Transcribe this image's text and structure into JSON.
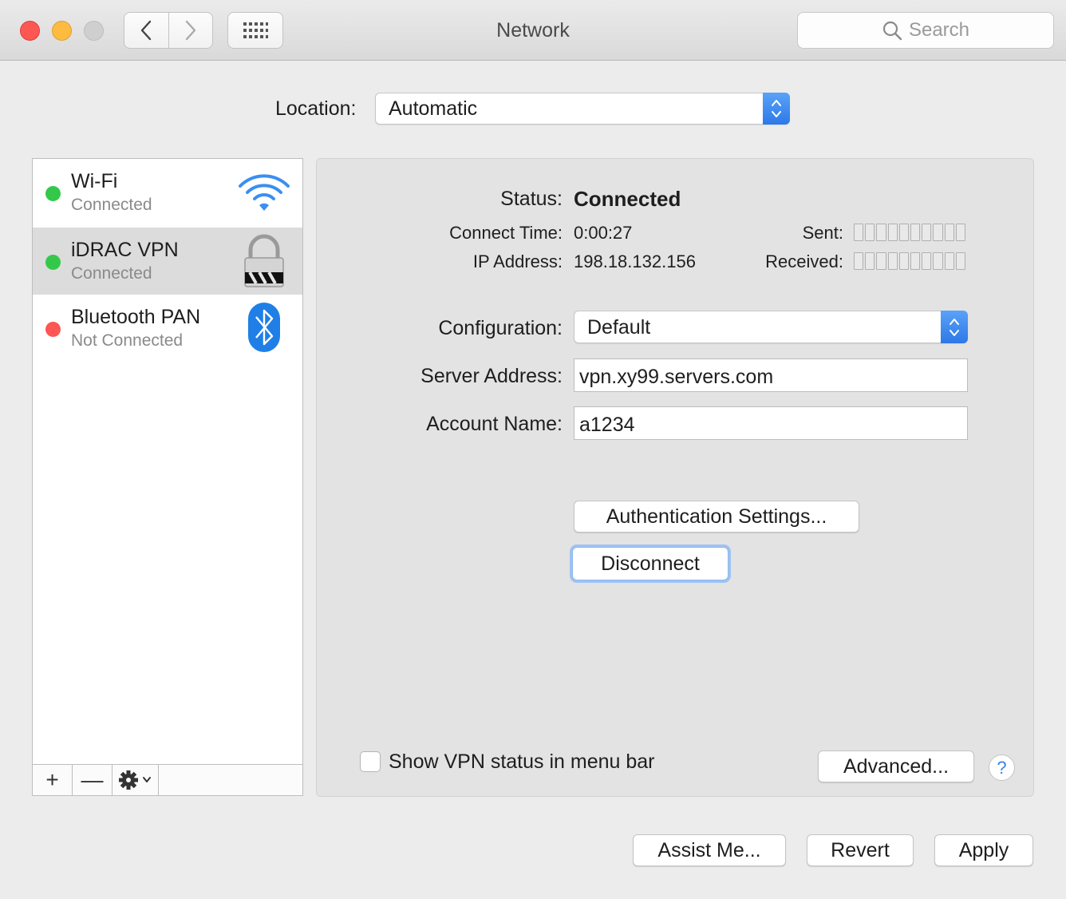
{
  "window": {
    "title": "Network",
    "search_placeholder": "Search"
  },
  "location": {
    "label": "Location:",
    "value": "Automatic"
  },
  "services": [
    {
      "name": "Wi-Fi",
      "status": "Connected",
      "status_color": "#34c84a",
      "icon": "wifi-icon"
    },
    {
      "name": "iDRAC VPN",
      "status": "Connected",
      "status_color": "#34c84a",
      "icon": "vpn-lock-icon"
    },
    {
      "name": "Bluetooth PAN",
      "status": "Not Connected",
      "status_color": "#fc5753",
      "icon": "bluetooth-icon"
    }
  ],
  "sidebar_toolbar": {
    "add": "+",
    "remove": "—"
  },
  "detail": {
    "status_label": "Status:",
    "status_value": "Connected",
    "connect_time_label": "Connect Time:",
    "connect_time_value": "0:00:27",
    "ip_label": "IP Address:",
    "ip_value": "198.18.132.156",
    "sent_label": "Sent:",
    "received_label": "Received:",
    "configuration_label": "Configuration:",
    "configuration_value": "Default",
    "server_label": "Server Address:",
    "server_value": "vpn.xy99.servers.com",
    "account_label": "Account Name:",
    "account_value": "a1234",
    "auth_button": "Authentication Settings...",
    "disconnect_button": "Disconnect",
    "show_vpn_label": "Show VPN status in menu bar",
    "advanced_button": "Advanced...",
    "help": "?"
  },
  "footer": {
    "assist": "Assist Me...",
    "revert": "Revert",
    "apply": "Apply"
  },
  "colors": {
    "accent": "#2d79e8"
  }
}
